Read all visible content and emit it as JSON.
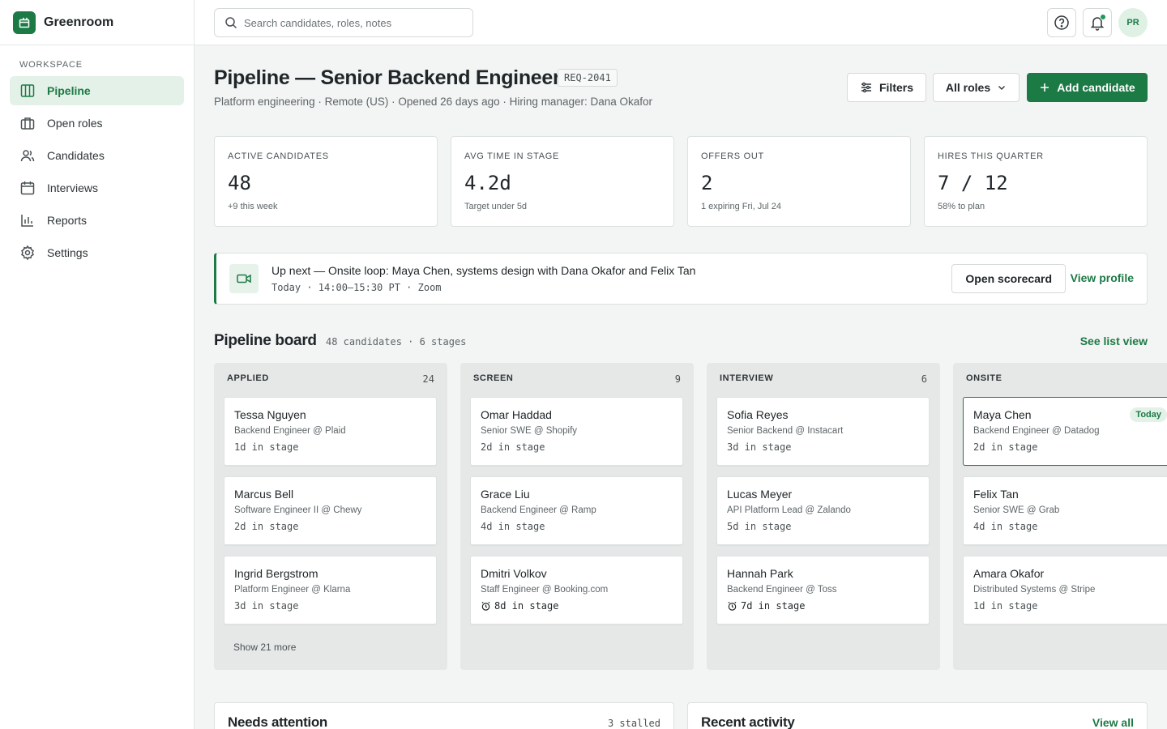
{
  "app": {
    "name": "Greenroom"
  },
  "sidebar": {
    "section_label": "WORKSPACE",
    "items": [
      {
        "label": "Pipeline",
        "icon": "columns-icon"
      },
      {
        "label": "Open roles",
        "icon": "briefcase-icon"
      },
      {
        "label": "Candidates",
        "icon": "users-icon"
      },
      {
        "label": "Interviews",
        "icon": "calendar-icon"
      },
      {
        "label": "Reports",
        "icon": "bar-chart-icon"
      },
      {
        "label": "Settings",
        "icon": "gear-icon"
      }
    ],
    "active": "Pipeline"
  },
  "topbar": {
    "search_placeholder": "Search candidates, roles, notes",
    "avatar_initials": "PR"
  },
  "header": {
    "title": "Pipeline — Senior Backend Engineer",
    "req_id": "REQ-2041",
    "subtitle": "Platform engineering · Remote (US) · Opened 26 days ago · Hiring manager: Dana Okafor",
    "filters_label": "Filters",
    "roles_select": "All roles",
    "add_label": "Add candidate"
  },
  "stats": [
    {
      "label": "ACTIVE CANDIDATES",
      "value": "48",
      "sub": "+9 this week"
    },
    {
      "label": "AVG TIME IN STAGE",
      "value": "4.2d",
      "sub": "Target under 5d"
    },
    {
      "label": "OFFERS OUT",
      "value": "2",
      "sub": "1 expiring Fri, Jul 24"
    },
    {
      "label": "HIRES THIS QUARTER",
      "value": "7 / 12",
      "sub": "58% to plan"
    }
  ],
  "up_next": {
    "title": "Up next — Onsite loop: Maya Chen, systems design with Dana Okafor and Felix Tan",
    "meta": "Today · 14:00–15:30 PT · Zoom",
    "scorecard_label": "Open scorecard",
    "profile_label": "View profile"
  },
  "board": {
    "title": "Pipeline board",
    "meta": "48 candidates · 6 stages",
    "list_view_label": "See list view",
    "columns": [
      {
        "name": "APPLIED",
        "count": "24",
        "cards": [
          {
            "name": "Tessa Nguyen",
            "role": "Backend Engineer @ Plaid",
            "stage": "1d in stage"
          },
          {
            "name": "Marcus Bell",
            "role": "Software Engineer II @ Chewy",
            "stage": "2d in stage"
          },
          {
            "name": "Ingrid Bergstrom",
            "role": "Platform Engineer @ Klarna",
            "stage": "3d in stage"
          }
        ],
        "show_more": "Show 21 more"
      },
      {
        "name": "SCREEN",
        "count": "9",
        "cards": [
          {
            "name": "Omar Haddad",
            "role": "Senior SWE @ Shopify",
            "stage": "2d in stage"
          },
          {
            "name": "Grace Liu",
            "role": "Backend Engineer @ Ramp",
            "stage": "4d in stage"
          },
          {
            "name": "Dmitri Volkov",
            "role": "Staff Engineer @ Booking.com",
            "stage": "8d in stage"
          }
        ]
      },
      {
        "name": "INTERVIEW",
        "count": "6",
        "cards": [
          {
            "name": "Sofia Reyes",
            "role": "Senior Backend @ Instacart",
            "stage": "3d in stage"
          },
          {
            "name": "Lucas Meyer",
            "role": "API Platform Lead @ Zalando",
            "stage": "5d in stage"
          },
          {
            "name": "Hannah Park",
            "role": "Backend Engineer @ Toss",
            "stage": "7d in stage"
          }
        ]
      },
      {
        "name": "ONSITE",
        "count": "",
        "cards": [
          {
            "name": "Maya Chen",
            "role": "Backend Engineer @ Datadog",
            "stage": "2d in stage",
            "badge": "Today"
          },
          {
            "name": "Felix Tan",
            "role": "Senior SWE @ Grab",
            "stage": "4d in stage"
          },
          {
            "name": "Amara Okafor",
            "role": "Distributed Systems @ Stripe",
            "stage": "1d in stage"
          }
        ]
      }
    ]
  },
  "needs_attention": {
    "title": "Needs attention",
    "meta": "3 stalled"
  },
  "recent_activity": {
    "title": "Recent activity",
    "link": "View all"
  },
  "colors": {
    "accent": "#1c7a45",
    "accent_soft": "#e3f1e8",
    "background": "#f3f4f4"
  }
}
